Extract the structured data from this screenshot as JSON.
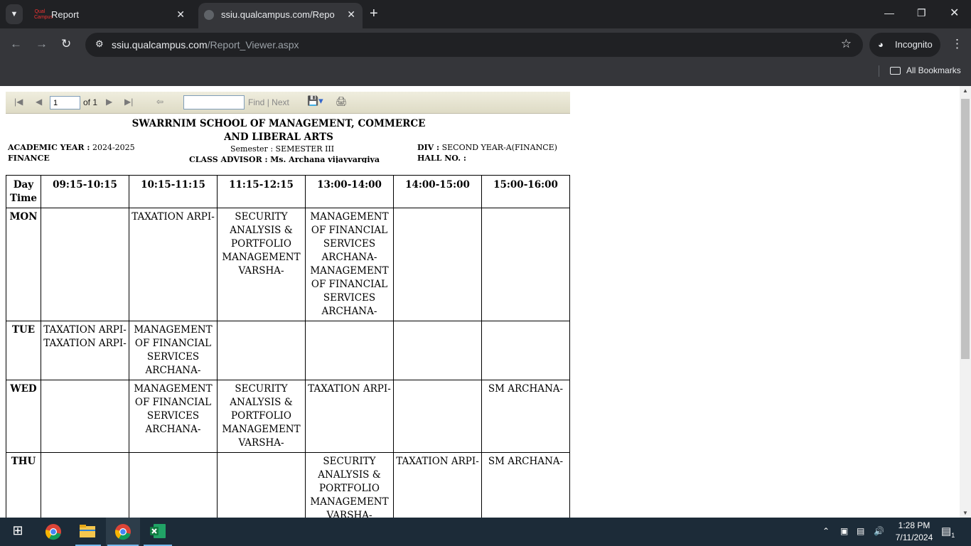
{
  "browser": {
    "tabs": [
      {
        "title": "Report",
        "favicon": "QualCampus"
      },
      {
        "title": "ssiu.qualcampus.com/Report_Vi"
      }
    ],
    "url_host": "ssiu.qualcampus.com",
    "url_path": "/Report_Viewer.aspx",
    "incognito_label": "Incognito",
    "bookmarks_label": "All Bookmarks"
  },
  "viewer": {
    "page_value": "1",
    "page_of": "of 1",
    "find_label": "Find",
    "next_label": "Next",
    "separator": "|"
  },
  "report": {
    "school_line1": "SWARRNIM SCHOOL OF MANAGEMENT, COMMERCE",
    "school_line2": "AND LIBERAL ARTS",
    "academic_year_label": "ACADEMIC YEAR :",
    "academic_year": "2024-2025",
    "program": "FINANCE",
    "semester_label": "Semester :",
    "semester": "SEMESTER III",
    "advisor_label": "CLASS ADVISOR :",
    "advisor": "Ms. Archana vijayvargiya",
    "div_label": "DIV :",
    "div": "SECOND YEAR-A(FINANCE)",
    "hall_label": "HALL NO. :",
    "hall": "",
    "header_day": "Day Time",
    "times": [
      "09:15-10:15",
      "10:15-11:15",
      "11:15-12:15",
      "13:00-14:00",
      "14:00-15:00",
      "15:00-16:00"
    ],
    "rows": [
      {
        "day": "MON",
        "cells": [
          "",
          "TAXATION ARPI-",
          "SECURITY ANALYSIS & PORTFOLIO MANAGEMENT VARSHA-",
          "MANAGEMENT OF FINANCIAL SERVICES ARCHANA- MANAGEMENT OF FINANCIAL SERVICES ARCHANA-",
          "",
          ""
        ]
      },
      {
        "day": "TUE",
        "cells": [
          "TAXATION ARPI- TAXATION ARPI-",
          "MANAGEMENT OF FINANCIAL SERVICES ARCHANA-",
          "",
          "",
          "",
          ""
        ]
      },
      {
        "day": "WED",
        "cells": [
          "",
          "MANAGEMENT OF FINANCIAL SERVICES ARCHANA-",
          "SECURITY ANALYSIS & PORTFOLIO MANAGEMENT VARSHA-",
          "TAXATION ARPI-",
          "",
          "SM ARCHANA-"
        ]
      },
      {
        "day": "THU",
        "cells": [
          "",
          "",
          "",
          "SECURITY ANALYSIS & PORTFOLIO MANAGEMENT VARSHA-",
          "TAXATION ARPI-",
          "SM ARCHANA-"
        ]
      }
    ]
  },
  "taskbar": {
    "time": "1:28 PM",
    "date": "7/11/2024",
    "notifications": "1"
  }
}
